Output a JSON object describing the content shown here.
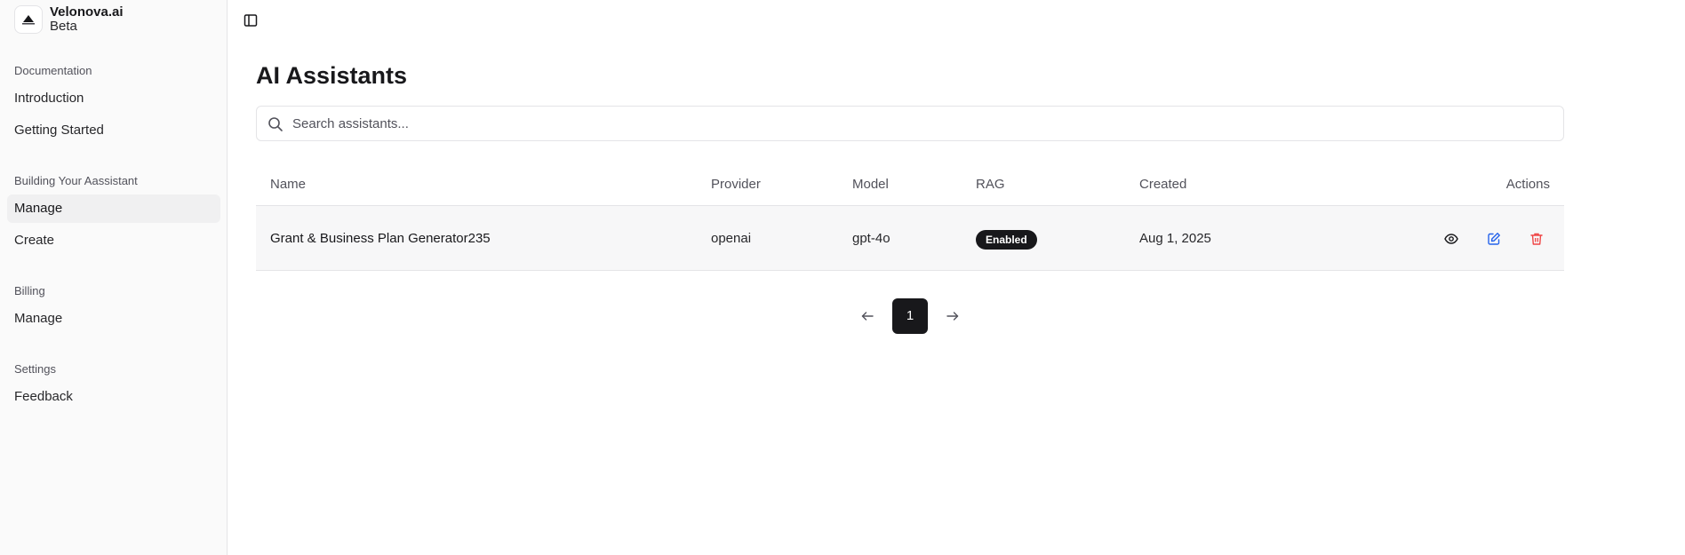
{
  "brand": {
    "name": "Velonova.ai",
    "subtitle": "Beta"
  },
  "sidebar": {
    "sections": [
      {
        "label": "Documentation",
        "items": [
          {
            "label": "Introduction"
          },
          {
            "label": "Getting Started"
          }
        ]
      },
      {
        "label": "Building Your Aassistant",
        "items": [
          {
            "label": "Manage",
            "active": true
          },
          {
            "label": "Create"
          }
        ]
      },
      {
        "label": "Billing",
        "items": [
          {
            "label": "Manage"
          }
        ]
      },
      {
        "label": "Settings",
        "items": [
          {
            "label": "Feedback"
          }
        ]
      }
    ]
  },
  "main": {
    "title": "AI Assistants",
    "search": {
      "placeholder": "Search assistants...",
      "value": ""
    },
    "table": {
      "columns": [
        "Name",
        "Provider",
        "Model",
        "RAG",
        "Created",
        "Actions"
      ],
      "rows": [
        {
          "name": "Grant & Business Plan Generator235",
          "provider": "openai",
          "model": "gpt-4o",
          "rag": "Enabled",
          "created": "Aug 1, 2025"
        }
      ]
    },
    "pagination": {
      "current_page": "1"
    }
  },
  "colors": {
    "accent": "#18181b",
    "edit": "#2563eb",
    "delete": "#ef4444",
    "sidebar_bg": "#fafafa"
  },
  "icons": {
    "sidebar_toggle": "panel-left-icon",
    "search": "search-icon",
    "view": "eye-icon",
    "edit": "pencil-square-icon",
    "delete": "trash-icon",
    "prev": "arrow-left-icon",
    "next": "arrow-right-icon"
  }
}
